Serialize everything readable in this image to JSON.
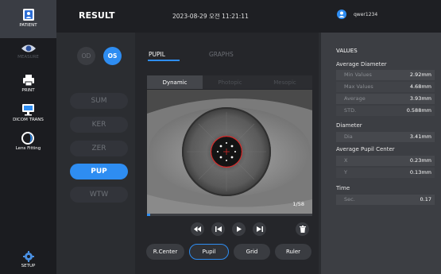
{
  "sidebar": {
    "items": [
      {
        "label": "PATIENT",
        "icon": "patient-icon"
      },
      {
        "label": "MEASURE",
        "icon": "eye-icon"
      },
      {
        "label": "PRINT",
        "icon": "printer-icon"
      },
      {
        "label": "DICOM TRANS",
        "icon": "monitor-icon"
      },
      {
        "label": "Lens Fitting",
        "icon": "lens-icon"
      },
      {
        "label": "SETUP",
        "icon": "gear-icon"
      }
    ]
  },
  "header": {
    "title": "RESULT",
    "datetime": "2023-08-29 오전 11:21:11",
    "username": "qwer1234"
  },
  "eye": {
    "od": "OD",
    "os": "OS",
    "selected": "OS"
  },
  "modes": [
    "SUM",
    "KER",
    "ZER",
    "PUP",
    "WTW"
  ],
  "active_mode": "PUP",
  "tabs": {
    "pupil": "PUPIL",
    "graphs": "GRAPHS"
  },
  "subtabs": [
    "Dynamic",
    "Photopic",
    "Mesopic"
  ],
  "viewer": {
    "frame": "1/58",
    "progress_fraction": 0.017
  },
  "tools": [
    "R.Center",
    "Pupil",
    "Grid",
    "Ruler"
  ],
  "active_tool": "Pupil",
  "values": {
    "title": "VALUES",
    "avg_diameter": {
      "label": "Average Diameter",
      "rows": [
        {
          "k": "Min Values",
          "v": "2.92mm"
        },
        {
          "k": "Max Values",
          "v": "4.68mm"
        },
        {
          "k": "Average",
          "v": "3.93mm"
        },
        {
          "k": "STD.",
          "v": "0.588mm"
        }
      ]
    },
    "diameter": {
      "label": "Diameter",
      "rows": [
        {
          "k": "Dia",
          "v": "3.41mm"
        }
      ]
    },
    "pupil_center": {
      "label": "Average Pupil Center",
      "rows": [
        {
          "k": "X",
          "v": "0.23mm"
        },
        {
          "k": "Y",
          "v": "0.13mm"
        }
      ]
    },
    "time": {
      "label": "Time",
      "rows": [
        {
          "k": "Sec.",
          "v": "0.17"
        }
      ]
    }
  },
  "colors": {
    "accent": "#2e8df2",
    "sidebar_bg": "#1b1c20",
    "panel_bg": "#3c3e43",
    "pupil_ring": "#d42a2a"
  }
}
